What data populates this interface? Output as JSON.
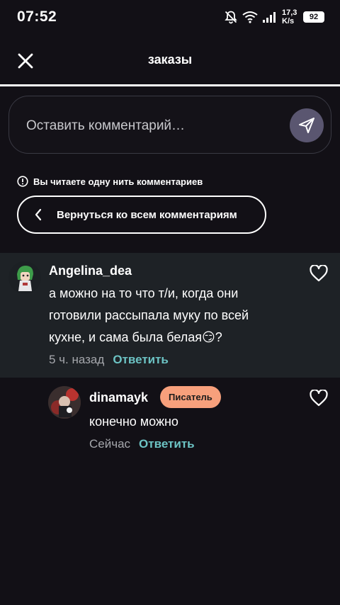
{
  "status_bar": {
    "time": "07:52",
    "net_speed_value": "17,3",
    "net_speed_unit": "K/s",
    "battery": "92",
    "icons": [
      "bell-off-icon",
      "wifi-icon",
      "signal-icon",
      "battery-icon"
    ]
  },
  "header": {
    "title": "заказы",
    "close_icon": "close-icon"
  },
  "comment_input": {
    "placeholder": "Оставить комментарий…",
    "value": "",
    "send_icon": "send-icon"
  },
  "thread": {
    "notice": "Вы читаете одну нить комментариев",
    "back_label": "Вернуться ко всем комментариям"
  },
  "comments": [
    {
      "username": "Angelina_dea",
      "text_lines": [
        "а можно на то что т/и, когда они",
        "готовили рассыпала муку по всей",
        "кухне, и сама была белая😏?"
      ],
      "time": "5 ч. назад",
      "reply_label": "Ответить"
    },
    {
      "username": "dinamayk",
      "badge": "Писатель",
      "text_lines": [
        "конечно можно"
      ],
      "time": "Сейчас",
      "reply_label": "Ответить"
    }
  ],
  "colors": {
    "background": "#121016",
    "comment_highlight": "#1e2226",
    "accent_reply": "#6cc3c4",
    "badge": "#f7a07c",
    "send_button": "#5a5670"
  }
}
